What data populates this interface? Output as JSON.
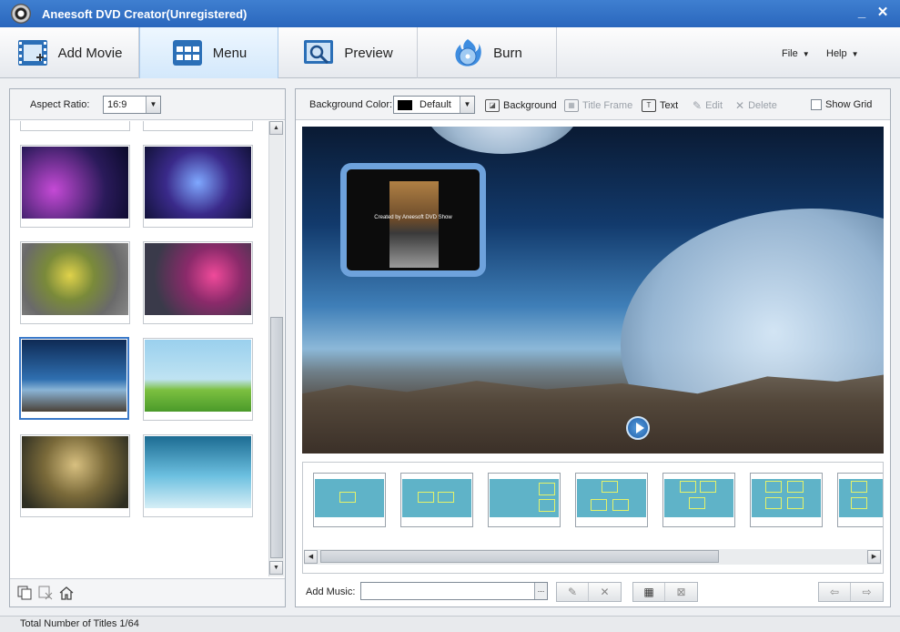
{
  "window": {
    "title": "Aneesoft DVD Creator(Unregistered)",
    "minimize": "_",
    "close": "✕"
  },
  "toolbar": {
    "add_movie": "Add Movie",
    "menu": "Menu",
    "preview": "Preview",
    "burn": "Burn",
    "active": "menu"
  },
  "menubar": {
    "file": "File",
    "help": "Help"
  },
  "left_panel": {
    "aspect_label": "Aspect Ratio:",
    "aspect_value": "16:9",
    "selected_template_index": 4
  },
  "right_toolbar": {
    "bg_color_label": "Background Color:",
    "bg_color_value": "Default",
    "background": "Background",
    "title_frame": "Title Frame",
    "text": "Text",
    "edit": "Edit",
    "delete": "Delete",
    "show_grid": "Show Grid",
    "show_grid_checked": false
  },
  "preview": {
    "frame_caption": "Created by Aneesoft DVD Show"
  },
  "bottom": {
    "add_music_label": "Add Music:",
    "add_music_value": "",
    "browse": "..."
  },
  "status": {
    "text": "Total Number of Titles 1/64"
  }
}
